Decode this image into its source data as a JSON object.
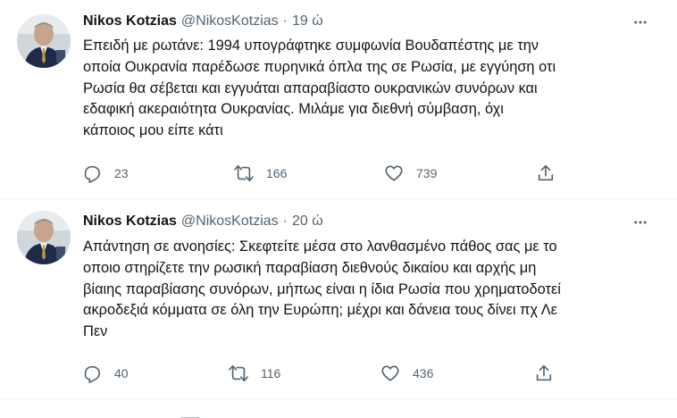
{
  "tweets": [
    {
      "author": "Nikos Kotzias",
      "handle": "@NikosKotzias",
      "separator": "·",
      "time": "19 ώ",
      "lines": [
        "Επειδή με ρωτάνε: 1994 υπογράφτηκε συμφωνία Βουδαπέστης με την",
        "οποία Ουκρανία παρέδωσε πυρηνικά όπλα της σε Ρωσία, με εγγύηση οτι",
        "Ρωσία θα σέβεται και εγγυάται απαραβίαστο ουκρανικών συνόρων και",
        "εδαφική ακεραιότητα Ουκρανίας. Μιλάμε για διεθνή σύμβαση, όχι",
        "κάποιος μου είπε κάτι"
      ],
      "replies": "23",
      "retweets": "166",
      "likes": "739"
    },
    {
      "author": "Nikos Kotzias",
      "handle": "@NikosKotzias",
      "separator": "·",
      "time": "20 ώ",
      "lines": [
        "Απάντηση σε ανοησίες: Σκεφτείτε μέσα στο λανθασμένο πάθος σας με το",
        "οποιο στηρίζετε την ρωσική παραβίαση διεθνούς δικαίου και αρχής μη",
        "βίαιης παραβίασης συνόρων, μήπως είναι η ίδια Ρωσία που χρηματοδοτεί",
        "ακροδεξιά κόμματα σε όλη την Ευρώπη; μέχρι και δάνεια τους δίνει πχ Λε",
        "Πεν"
      ],
      "replies": "40",
      "retweets": "116",
      "likes": "436"
    }
  ],
  "icons": {
    "more": "more-horizontal-icon",
    "reply": "reply-bubble-icon",
    "retweet": "retweet-arrows-icon",
    "like": "heart-icon",
    "share": "share-upload-icon"
  },
  "colors": {
    "text": "#0f1419",
    "secondary": "#536471",
    "divider": "#eff3f4"
  }
}
